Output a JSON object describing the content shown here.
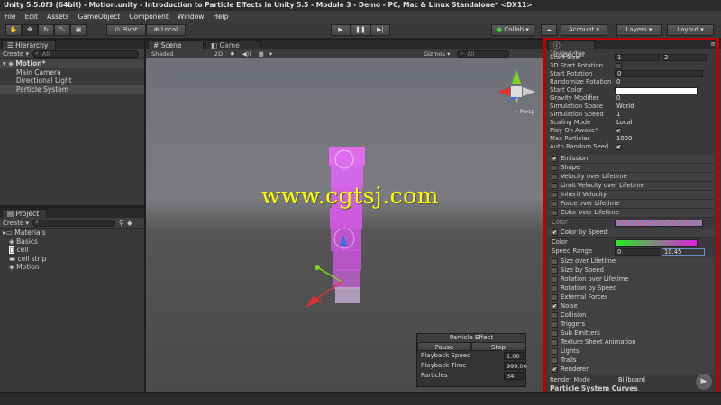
{
  "window": {
    "title": "Unity 5.5.0f3 (64bit) - Motion.unity - Introduction to Particle Effects in Unity 5.5 - Module 3 - Demo - PC, Mac & Linux Standalone* <DX11>"
  },
  "menu": [
    "File",
    "Edit",
    "Assets",
    "GameObject",
    "Component",
    "Window",
    "Help"
  ],
  "toolbar": {
    "tools": [
      "hand",
      "move",
      "rotate",
      "scale",
      "rect"
    ],
    "pivot_label": "Pivot",
    "local_label": "Local",
    "collab_label": "Collab ▾",
    "account_label": "Account",
    "layers_label": "Layers",
    "layout_label": "Layout"
  },
  "hierarchy": {
    "tab": "Hierarchy",
    "create_label": "Create ▾",
    "search_placeholder": "All",
    "scene_name": "Motion*",
    "items": [
      "Main Camera",
      "Directional Light",
      "Particle System"
    ]
  },
  "project": {
    "tab": "Project",
    "create_label": "Create ▾",
    "folder": "Materials",
    "items": [
      "Basics",
      "cell",
      "cell strip",
      "Motion"
    ]
  },
  "scene": {
    "tabs": [
      "Scene",
      "Game"
    ],
    "shading": "Shaded",
    "mode_2d": "2D",
    "gizmos_label": "Gizmos ▾",
    "search_placeholder": "All"
  },
  "watermark": "www.cgtsj.com",
  "particle_effect": {
    "title": "Particle Effect",
    "pause_label": "Pause",
    "stop_label": "Stop",
    "rows": [
      {
        "label": "Playback Speed",
        "value": "1.00"
      },
      {
        "label": "Playback Time",
        "value": "999.00"
      },
      {
        "label": "Particles",
        "value": "34"
      }
    ]
  },
  "inspector": {
    "tab": "Inspector",
    "cut_label": "3D Start Size",
    "props": [
      {
        "label": "Start Size",
        "v1": "1",
        "v2": "2"
      },
      {
        "label": "3D Start Rotation",
        "check": ""
      },
      {
        "label": "Start Rotation",
        "v1": "0"
      },
      {
        "label": "Randomize Rotation",
        "v1": "0"
      },
      {
        "label": "Start Color"
      },
      {
        "label": "Gravity Modifier",
        "v1": "0"
      },
      {
        "label": "Simulation Space",
        "v1": "World"
      },
      {
        "label": "Simulation Speed",
        "v1": "1"
      },
      {
        "label": "Scaling Mode",
        "v1": "Local"
      },
      {
        "label": "Play On Awake*",
        "check": "✔"
      },
      {
        "label": "Max Particles",
        "v1": "1000"
      },
      {
        "label": "Auto Random Seed",
        "check": "✔"
      }
    ],
    "modules_a": [
      {
        "label": "Emission",
        "on": "✔"
      },
      {
        "label": "Shape",
        "on": ""
      },
      {
        "label": "Velocity over Lifetime",
        "on": ""
      },
      {
        "label": "Limit Velocity over Lifetime",
        "on": ""
      },
      {
        "label": "Inherit Velocity",
        "on": ""
      },
      {
        "label": "Force over Lifetime",
        "on": ""
      },
      {
        "label": "Color over Lifetime",
        "on": ""
      }
    ],
    "color_label": "Color",
    "color_by_speed": {
      "label": "Color by Speed",
      "on": "✔",
      "color_label": "Color",
      "range_label": "Speed Range",
      "range_min": "0",
      "range_max": "10.45"
    },
    "modules_b": [
      {
        "label": "Size over Lifetime",
        "on": ""
      },
      {
        "label": "Size by Speed",
        "on": ""
      },
      {
        "label": "Rotation over Lifetime",
        "on": ""
      },
      {
        "label": "Rotation by Speed",
        "on": ""
      },
      {
        "label": "External Forces",
        "on": ""
      },
      {
        "label": "Noise",
        "on": "✔"
      },
      {
        "label": "Collision",
        "on": ""
      },
      {
        "label": "Triggers",
        "on": ""
      },
      {
        "label": "Sub Emitters",
        "on": ""
      },
      {
        "label": "Texture Sheet Animation",
        "on": ""
      },
      {
        "label": "Lights",
        "on": ""
      },
      {
        "label": "Trails",
        "on": ""
      },
      {
        "label": "Renderer",
        "on": "✔"
      }
    ],
    "render_mode_label": "Render Mode",
    "render_mode_value": "Billboard",
    "curves_label": "Particle System Curves"
  },
  "colors": {
    "accent_red": "#c00000",
    "watermark": "#ffff00",
    "particle": "#e040ff"
  }
}
